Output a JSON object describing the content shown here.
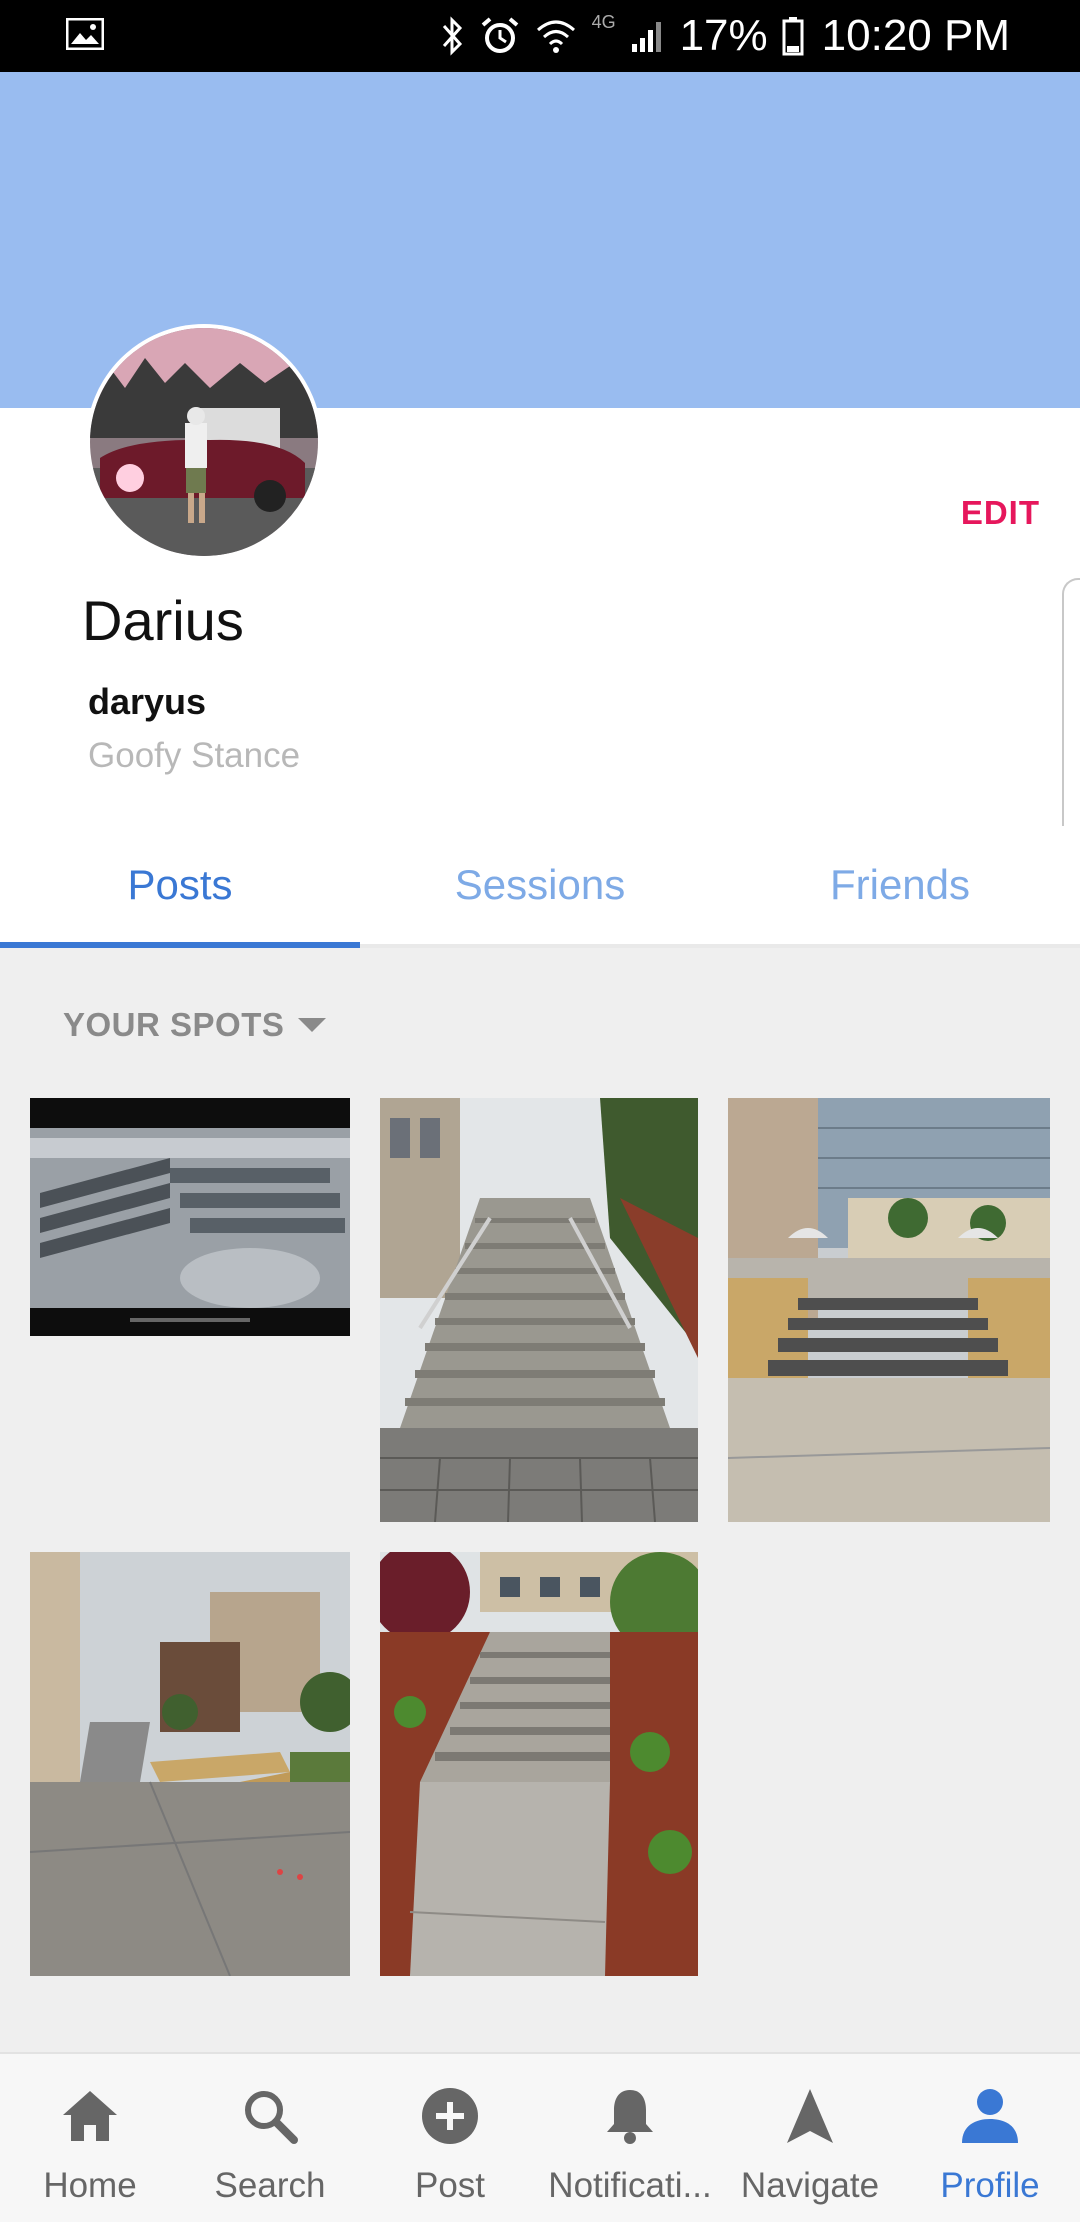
{
  "status_bar": {
    "battery_percent": "17%",
    "time": "10:20 PM",
    "network": "4G",
    "icons": [
      "gallery-icon",
      "bluetooth-icon",
      "alarm-icon",
      "wifi-icon",
      "signal-icon",
      "battery-icon"
    ]
  },
  "profile": {
    "display_name": "Darius",
    "username": "daryus",
    "stance": "Goofy Stance",
    "edit_label": "EDIT",
    "cover_color": "#99bcf0"
  },
  "tabs": [
    {
      "label": "Posts",
      "active": true
    },
    {
      "label": "Sessions",
      "active": false
    },
    {
      "label": "Friends",
      "active": false
    }
  ],
  "spots": {
    "filter_label": "YOUR SPOTS",
    "photos": [
      {
        "name": "spot-photo-skatepark-steps"
      },
      {
        "name": "spot-photo-long-stairs-handrails"
      },
      {
        "name": "spot-photo-brick-stairs-campus"
      },
      {
        "name": "spot-photo-walkway-ledge"
      },
      {
        "name": "spot-photo-garden-stairs"
      }
    ]
  },
  "bottom_nav": [
    {
      "label": "Home",
      "icon": "home-icon",
      "active": false
    },
    {
      "label": "Search",
      "icon": "search-icon",
      "active": false
    },
    {
      "label": "Post",
      "icon": "add-circle-icon",
      "active": false
    },
    {
      "label": "Notificati...",
      "icon": "bell-icon",
      "active": false
    },
    {
      "label": "Navigate",
      "icon": "navigation-arrow-icon",
      "active": false
    },
    {
      "label": "Profile",
      "icon": "person-icon",
      "active": true
    }
  ],
  "colors": {
    "accent": "#3a78d4",
    "tab_inactive": "#7eaae6",
    "edit": "#e6175c"
  }
}
